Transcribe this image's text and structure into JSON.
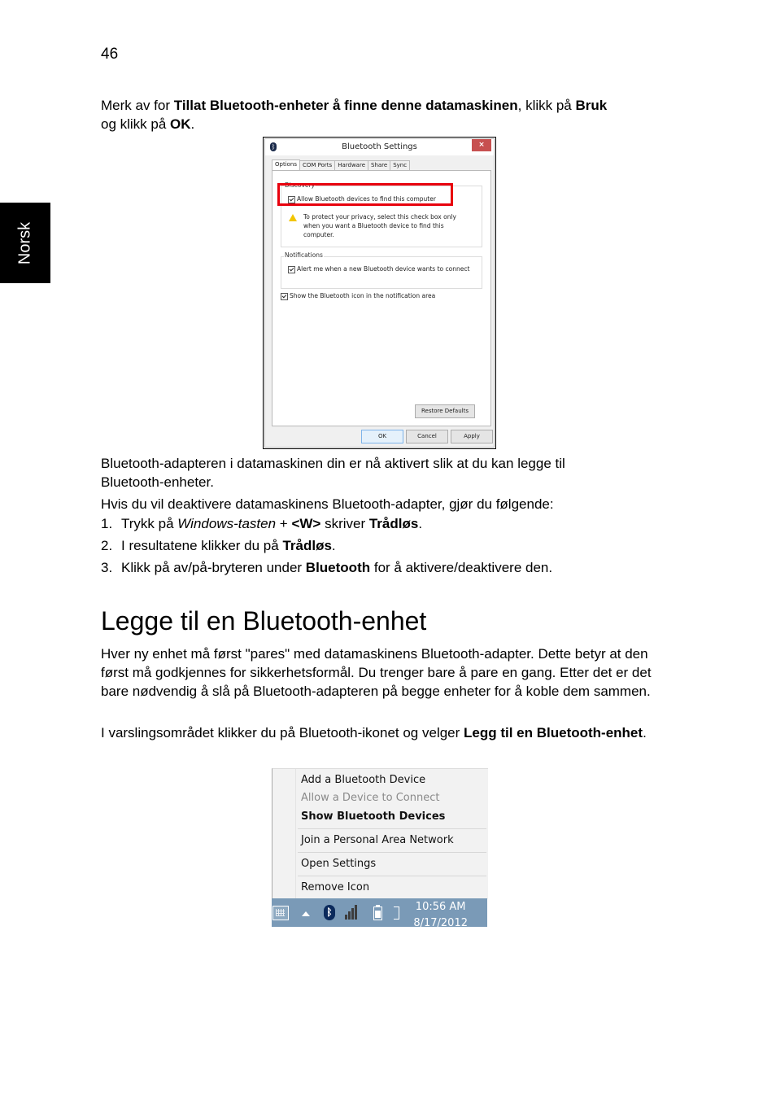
{
  "page_number": "46",
  "side_tab_label": "Norsk",
  "intro": {
    "t1": "Merk av for ",
    "b1": "Tillat Bluetooth-enheter å finne denne datamaskinen",
    "t2": ", klikk på ",
    "b2": "Bruk",
    "t3": "og klikk på ",
    "b3": "OK",
    "t4": "."
  },
  "dialog": {
    "title": "Bluetooth Settings",
    "close_label": "×",
    "tabs": [
      "Options",
      "COM Ports",
      "Hardware",
      "Share",
      "Sync"
    ],
    "discovery_label": "Discovery",
    "allow_discovery": "Allow Bluetooth devices to find this computer",
    "allow_discovery_checked": true,
    "privacy_warning": "To protect your privacy, select this check box only when you want a Bluetooth device to find this computer.",
    "notifications_label": "Notifications",
    "alert_new_device": "Alert me when a new Bluetooth device wants to connect",
    "alert_new_device_checked": true,
    "show_icon": "Show the Bluetooth icon in the notification area",
    "show_icon_checked": true,
    "restore_defaults": "Restore Defaults",
    "ok": "OK",
    "cancel": "Cancel",
    "apply": "Apply"
  },
  "para1_a": "Bluetooth-adapteren i datamaskinen din er nå aktivert slik at du kan legge til",
  "para1_b": "Bluetooth-enheter.",
  "para2": "Hvis du vil deaktivere datamaskinens Bluetooth-adapter, gjør du følgende:",
  "steps": [
    {
      "num": "1.",
      "t1": "Trykk på ",
      "i1": "Windows-tasten",
      "t2": " + ",
      "b1": "<W>",
      "t3": " skriver ",
      "b2": "Trådløs",
      "t4": "."
    },
    {
      "num": "2.",
      "t1": "I resultatene klikker du på ",
      "b1": "Trådløs",
      "t2": "."
    },
    {
      "num": "3.",
      "t1": "Klikk på av/på-bryteren under ",
      "b1": "Bluetooth",
      "t2": " for å aktivere/deaktivere den."
    }
  ],
  "heading": "Legge til en Bluetooth-enhet",
  "para3": "Hver ny enhet må først \"pares\" med datamaskinens Bluetooth-adapter. Dette betyr at den først må godkjennes for sikkerhetsformål. Du trenger bare å pare en gang. Etter det er det bare nødvendig å slå på Bluetooth-adapteren på begge enheter for å koble dem sammen.",
  "para4": {
    "t1": "I varslingsområdet klikker du på Bluetooth-ikonet og velger ",
    "b1": "Legg til en Bluetooth-enhet",
    "t2": "."
  },
  "context_menu": {
    "items": [
      {
        "label": "Add a Bluetooth Device",
        "state": "normal"
      },
      {
        "label": "Allow a Device to Connect",
        "state": "disabled"
      },
      {
        "label": "Show Bluetooth Devices",
        "state": "bold"
      },
      {
        "label": "Join a Personal Area Network",
        "state": "normal"
      },
      {
        "label": "Open Settings",
        "state": "normal"
      },
      {
        "label": "Remove Icon",
        "state": "normal"
      }
    ]
  },
  "taskbar": {
    "time": "10:56 AM",
    "date": "8/17/2012",
    "bluetooth_glyph": "ᛒ"
  },
  "colors": {
    "highlight_box": "#e8000d",
    "close_button": "#c75050",
    "taskbar": "#7a9ab7"
  }
}
